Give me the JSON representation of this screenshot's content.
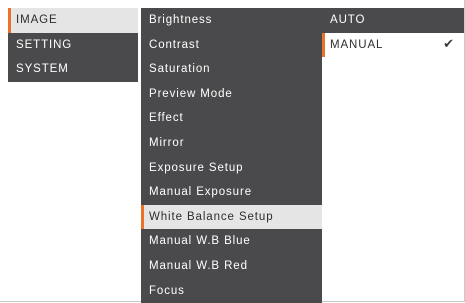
{
  "main_menu": {
    "items": [
      {
        "label": "IMAGE"
      },
      {
        "label": "SETTING"
      },
      {
        "label": "SYSTEM"
      }
    ],
    "selected": "IMAGE"
  },
  "image_menu": {
    "items": [
      {
        "label": "Brightness"
      },
      {
        "label": "Contrast"
      },
      {
        "label": "Saturation"
      },
      {
        "label": "Preview Mode"
      },
      {
        "label": "Effect"
      },
      {
        "label": "Mirror"
      },
      {
        "label": "Exposure Setup"
      },
      {
        "label": "Manual Exposure"
      },
      {
        "label": "White Balance Setup"
      },
      {
        "label": "Manual W.B Blue"
      },
      {
        "label": "Manual W.B Red"
      },
      {
        "label": "Focus"
      }
    ],
    "selected": "White Balance Setup"
  },
  "white_balance_options": {
    "items": [
      {
        "label": "AUTO"
      },
      {
        "label": "MANUAL",
        "checked": true,
        "check_glyph": "✔"
      }
    ],
    "selected": "MANUAL",
    "check_icon": "checkmark-icon"
  },
  "colors": {
    "menu_background": "#4a4a4c",
    "selected_background": "#e5e5e5",
    "accent": "#e8742a",
    "text_light": "#ffffff",
    "text_dark": "#2d2d2d"
  }
}
